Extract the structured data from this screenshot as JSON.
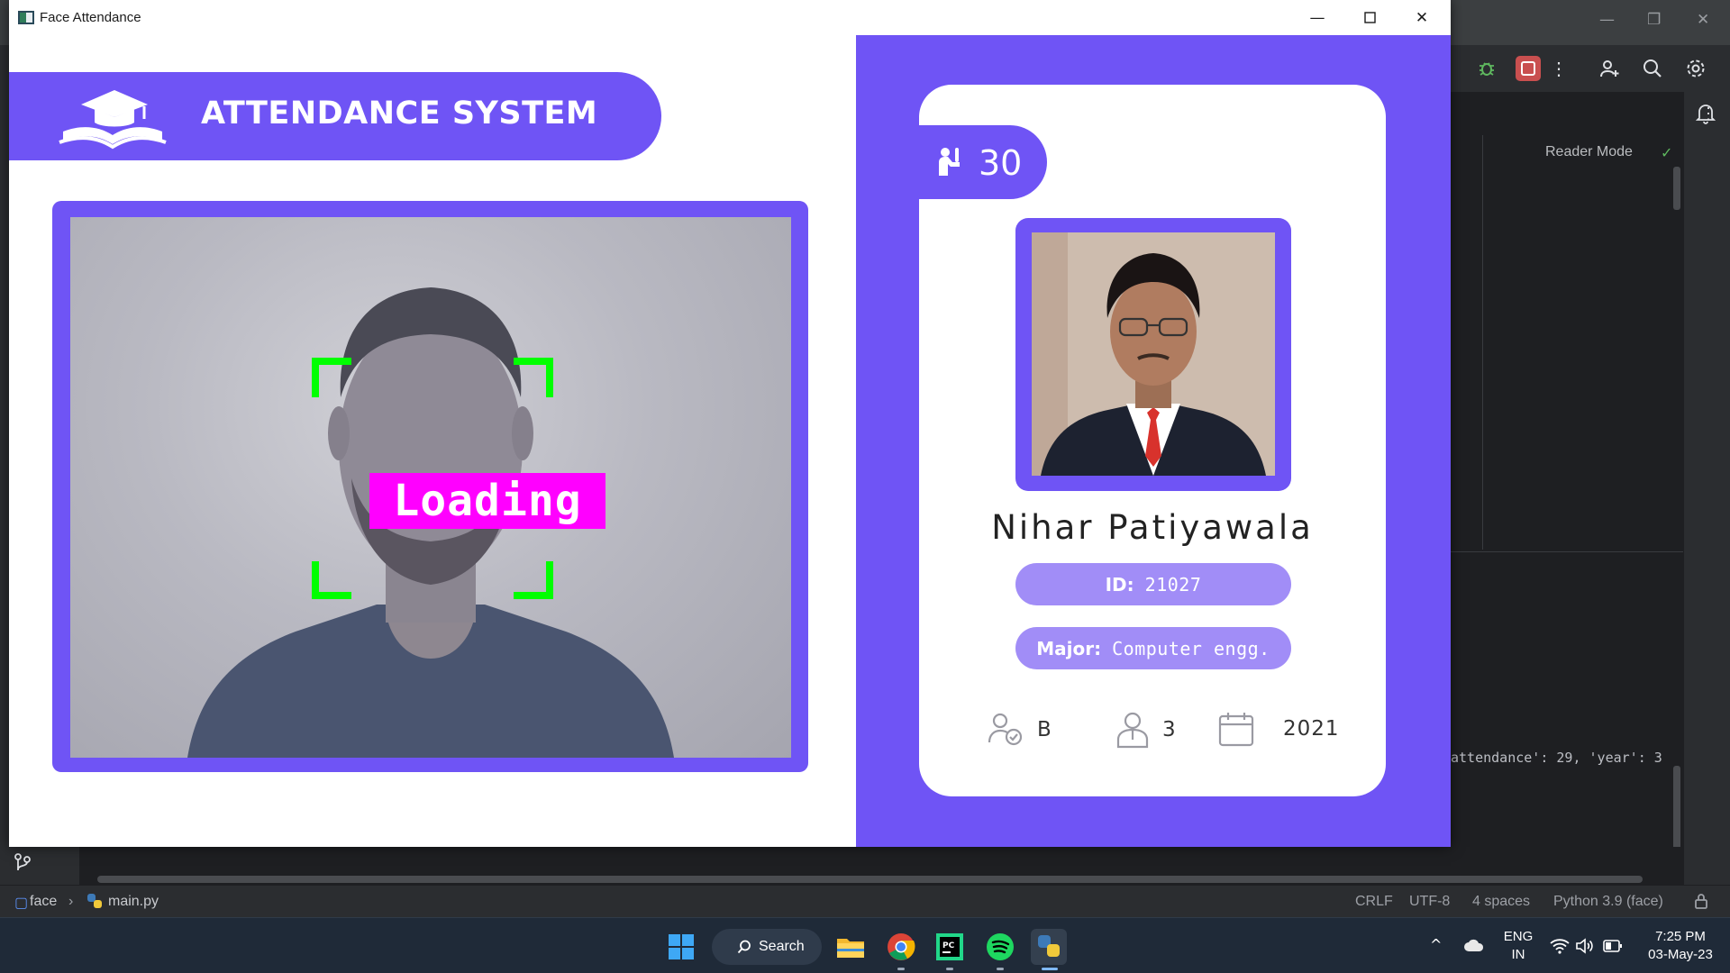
{
  "app_window": {
    "title": "Face Attendance",
    "header_title": "ATTENDANCE SYSTEM",
    "webcam": {
      "status_label": "Loading"
    },
    "student_card": {
      "total_attendance": "30",
      "name": "Nihar Patiyawala",
      "id_label": "ID:",
      "id_value": "21027",
      "major_label": "Major:",
      "major_value": "Computer engg.",
      "standing": "B",
      "year": "3",
      "starting_year": "2021"
    }
  },
  "ide": {
    "reader_mode": "Reader Mode",
    "console_output": "attendance': 29, 'year': 3",
    "breadcrumb_project": "face",
    "breadcrumb_file": "main.py",
    "status": {
      "line_ending": "CRLF",
      "encoding": "UTF-8",
      "indent": "4 spaces",
      "interpreter": "Python 3.9 (face)"
    }
  },
  "taskbar": {
    "search_label": "Search",
    "language": "ENG",
    "region": "IN",
    "time": "7:25 PM",
    "date": "03-May-23"
  },
  "colors": {
    "brand_purple": "#6f54f5",
    "pill_purple": "#a18df7",
    "loading_magenta": "#ff00ff",
    "face_box_green": "#00ff00"
  }
}
